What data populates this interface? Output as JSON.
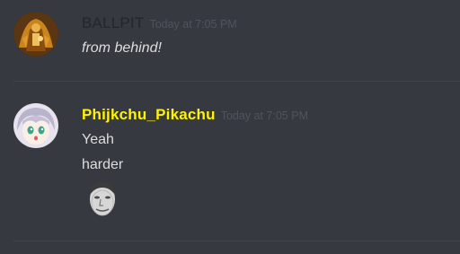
{
  "messages": [
    {
      "author": "BALLPIT",
      "author_color": "#23272a",
      "timestamp": "Today at 7:05 PM",
      "lines": [
        "from behind!"
      ],
      "avatar_icon": "character-avatar-icon"
    },
    {
      "author": "Phijkchu_Pikachu",
      "author_color": "#fff300",
      "timestamp": "Today at 7:05 PM",
      "lines": [
        "Yeah",
        "harder"
      ],
      "avatar_icon": "anime-girl-avatar-icon",
      "emoji_icon": "kappa-face-emoji-icon"
    }
  ],
  "colors": {
    "background": "#36393f",
    "text": "#dcddde",
    "timestamp": "#4f545c",
    "divider": "#42454a"
  }
}
